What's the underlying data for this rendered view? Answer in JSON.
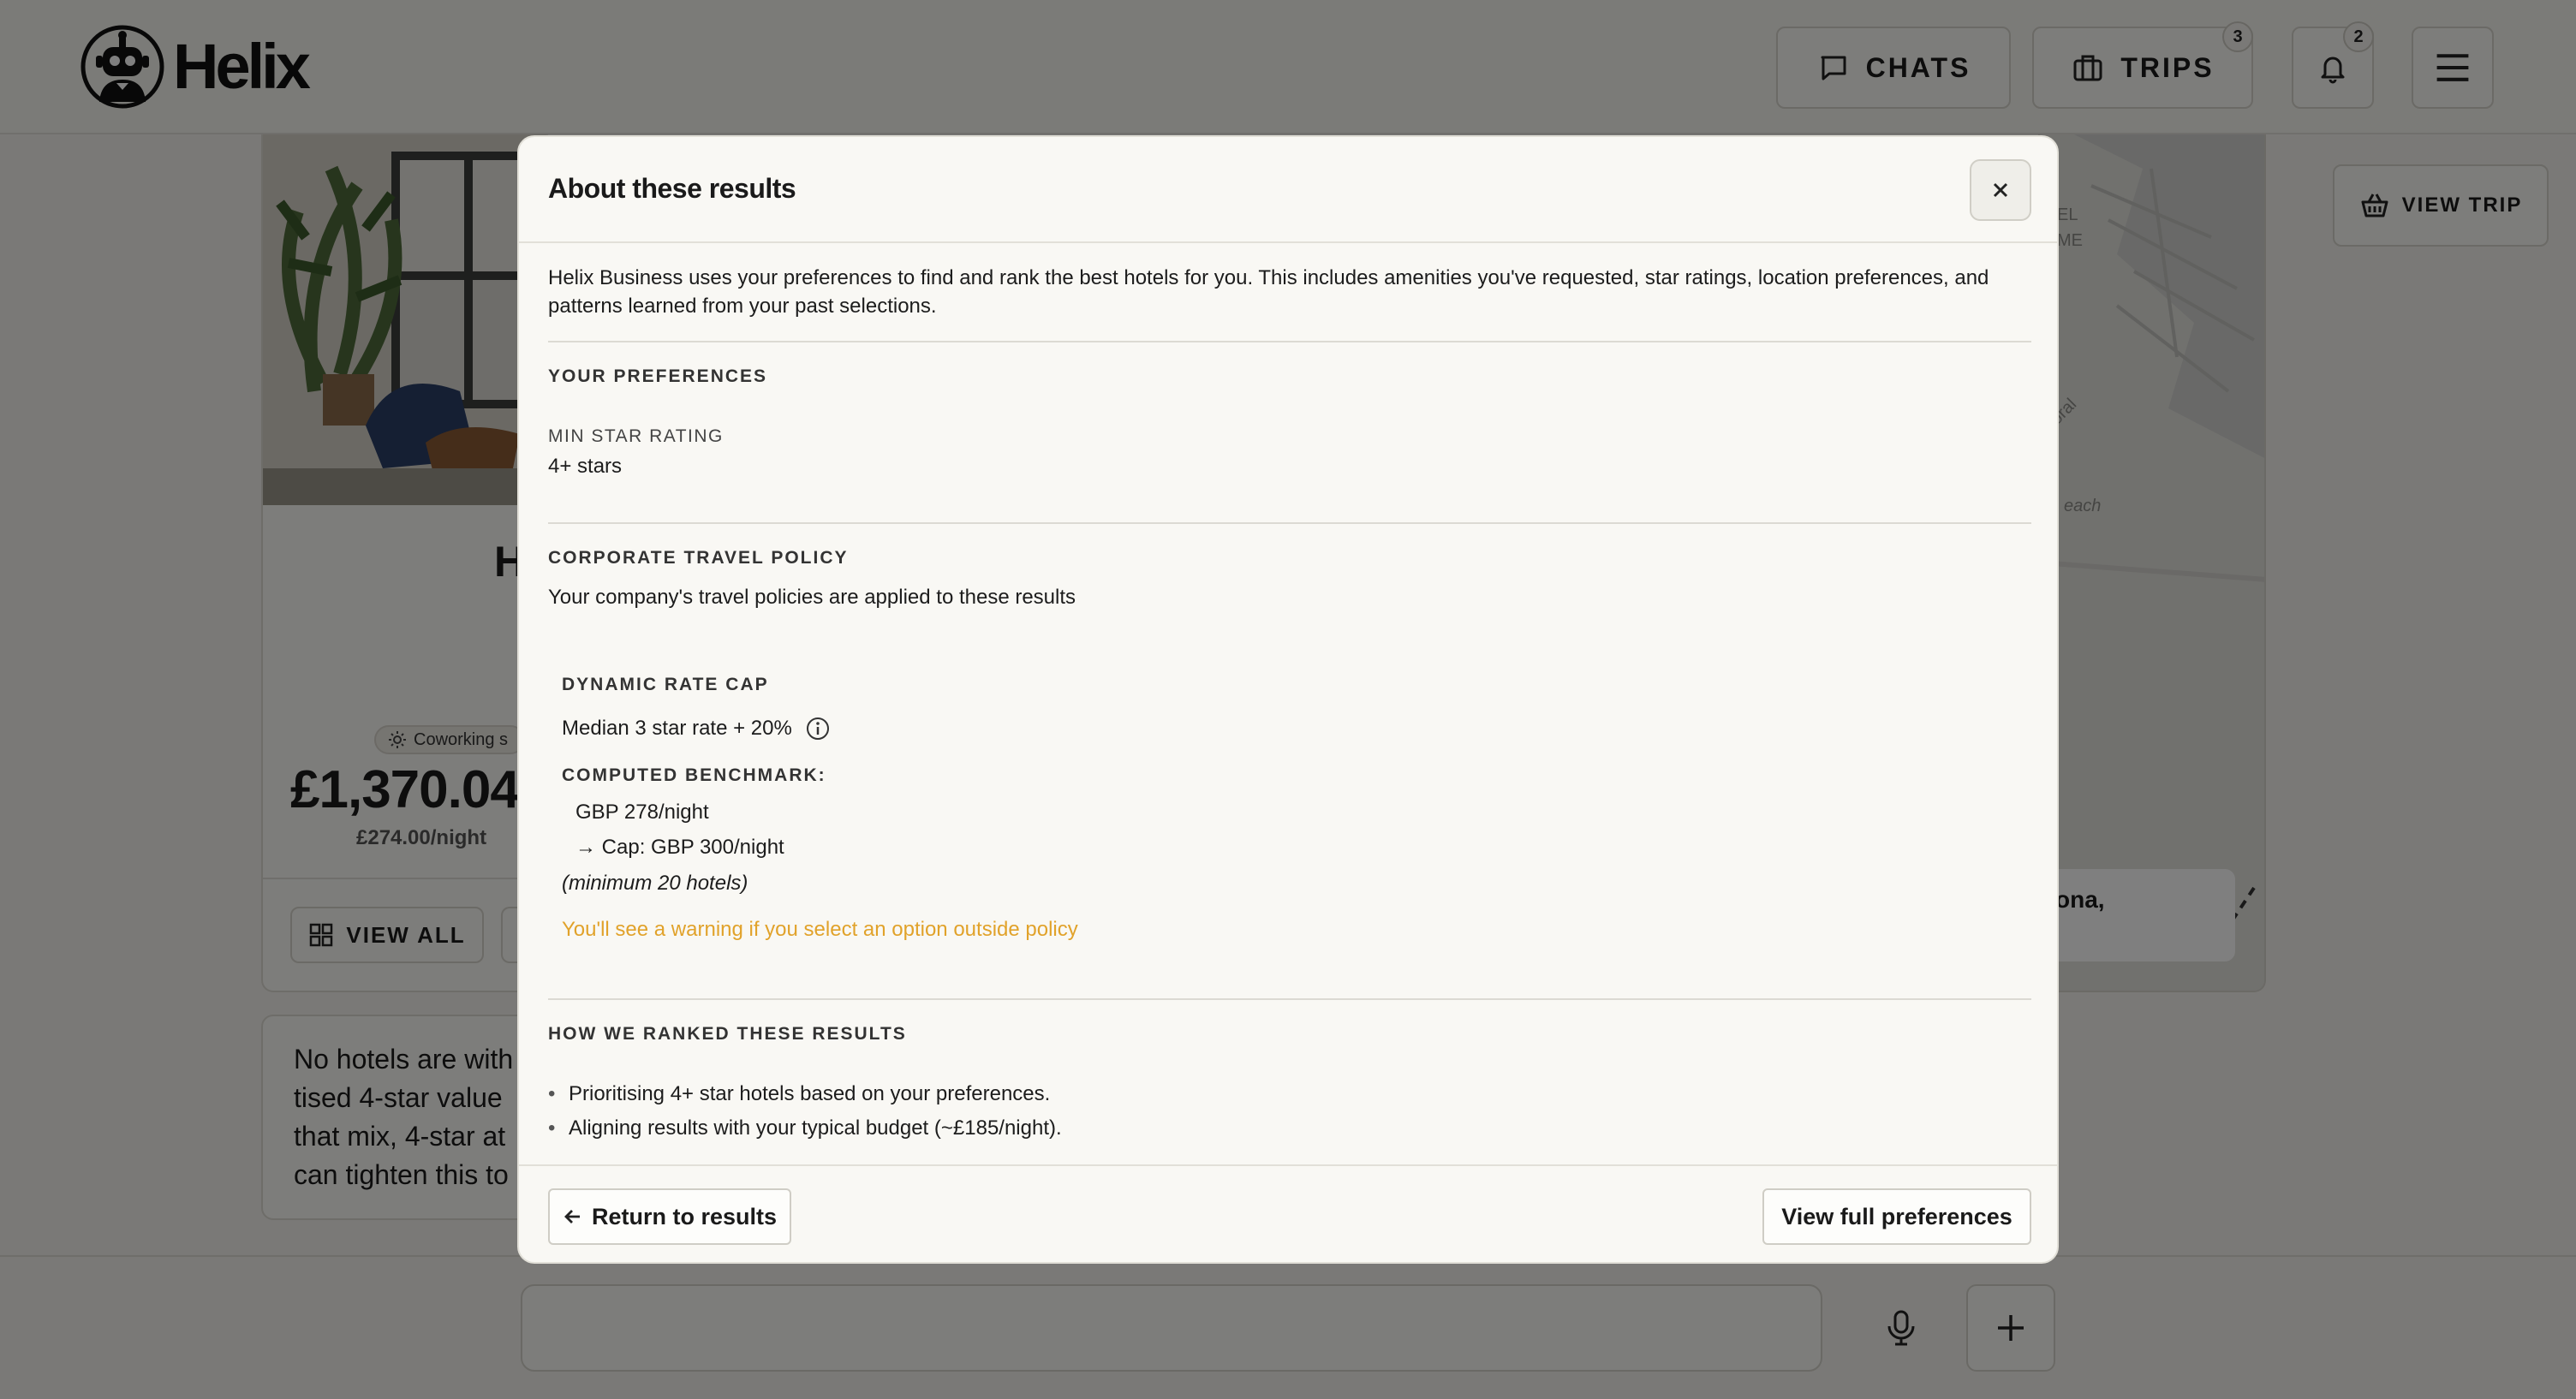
{
  "app": {
    "name": "Helix"
  },
  "header": {
    "chats_label": "CHATS",
    "trips_label": "TRIPS",
    "trips_badge": "3",
    "notifications_badge": "2"
  },
  "background": {
    "hotel_card": {
      "title_fragment": "H",
      "tag": "Coworking s",
      "price": "£1,370.04",
      "per_night": "£274.00/night",
      "view_all_label": "VIEW ALL"
    },
    "assistant_message_lines": [
      "No hotels are with",
      "tised 4-star value",
      "that mix, 4-star at",
      "can tighten this to"
    ],
    "map": {
      "popup_text": "ona,",
      "labels": [
        "EL",
        "ME",
        "oral",
        "each"
      ]
    },
    "view_trip_label": "VIEW TRIP"
  },
  "modal": {
    "title": "About these results",
    "intro_line1": "Helix Business uses your preferences to find and rank the best hotels for you. This includes amenities you've requested, star ratings, location preferences, and",
    "intro_line2": "patterns learned from your past selections.",
    "preferences": {
      "heading": "YOUR PREFERENCES",
      "min_star_label": "MIN STAR RATING",
      "min_star_value": "4+ stars"
    },
    "policy": {
      "heading": "CORPORATE TRAVEL POLICY",
      "description": "Your company's travel policies are applied to these results",
      "rate_cap_label": "DYNAMIC RATE CAP",
      "rate_cap_value": "Median 3 star rate + 20%",
      "benchmark_label": "COMPUTED BENCHMARK:",
      "benchmark_value": "GBP 278/night",
      "cap_value": "→ Cap: GBP 300/night",
      "min_hotels": "(minimum 20 hotels)",
      "warning": "You'll see a warning if you select an option outside policy"
    },
    "ranking": {
      "heading": "HOW WE RANKED THESE RESULTS",
      "bullets": [
        "Prioritising 4+ star hotels based on your preferences.",
        "Aligning results with your typical budget (~£185/night)."
      ]
    },
    "return_label": "Return to results",
    "view_prefs_label": "View full preferences"
  }
}
